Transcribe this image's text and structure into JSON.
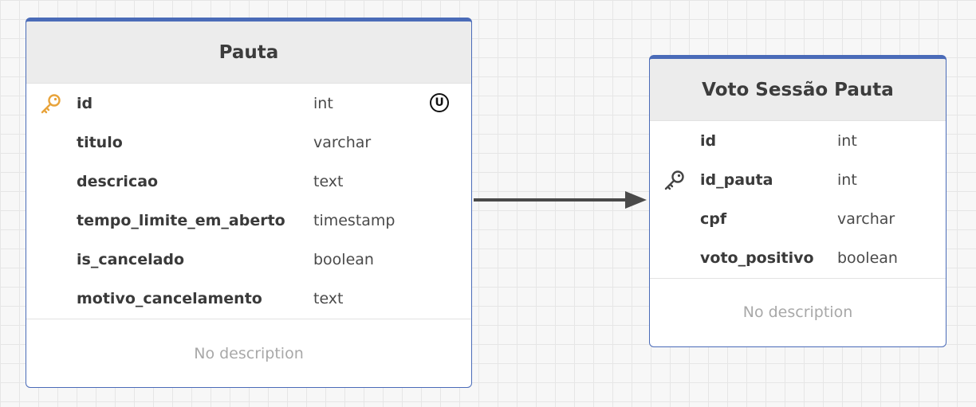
{
  "colors": {
    "table_border": "#4a6bb8",
    "primary_key": "#e8a33a",
    "foreign_key": "#444444",
    "relation_line": "#4a4a4a"
  },
  "tables": [
    {
      "name": "Pauta",
      "columns": [
        {
          "name": "id",
          "type": "int",
          "key": "primary-key-icon",
          "constraint": "U"
        },
        {
          "name": "titulo",
          "type": "varchar"
        },
        {
          "name": "descricao",
          "type": "text"
        },
        {
          "name": "tempo_limite_em_aberto",
          "type": "timestamp"
        },
        {
          "name": "is_cancelado",
          "type": "boolean"
        },
        {
          "name": "motivo_cancelamento",
          "type": "text"
        }
      ],
      "description": "No description"
    },
    {
      "name": "Voto Sessão Pauta",
      "columns": [
        {
          "name": "id",
          "type": "int"
        },
        {
          "name": "id_pauta",
          "type": "int",
          "key": "foreign-key-icon"
        },
        {
          "name": "cpf",
          "type": "varchar"
        },
        {
          "name": "voto_positivo",
          "type": "boolean"
        }
      ],
      "description": "No description"
    }
  ],
  "relations": [
    {
      "from": "Pauta",
      "to": "Voto Sessão Pauta",
      "arrow": "arrowhead"
    }
  ]
}
